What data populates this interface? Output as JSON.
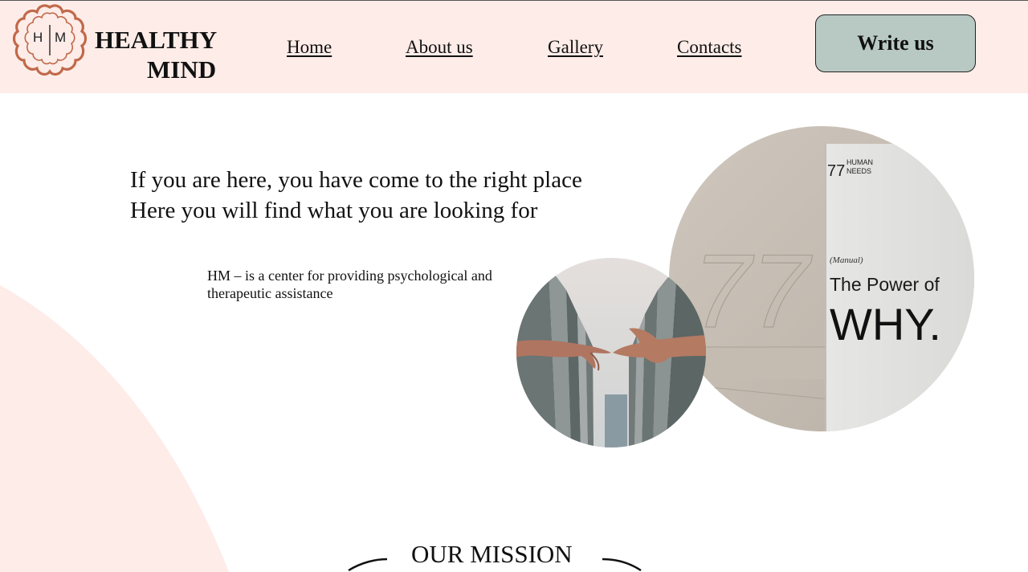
{
  "header": {
    "logo": {
      "icon": "flower-logo-icon",
      "letters_left": "H",
      "letters_right": "M",
      "color": "#c0694a"
    },
    "brand": {
      "line1": "HEALTHY",
      "line2": "MIND"
    },
    "nav": [
      {
        "label": "Home"
      },
      {
        "label": "About us"
      },
      {
        "label": "Gallery"
      },
      {
        "label": "Contacts"
      }
    ],
    "cta_label": "Write us",
    "background": "#fdece8",
    "cta_color": "#b8c9c4"
  },
  "hero": {
    "title_line1": "If you are here, you have come to the right place",
    "title_line2": "Here you will find what you are looking for",
    "description": "HM – is a center for providing psychological and therapeutic assistance"
  },
  "images": {
    "book": {
      "number": "77",
      "book_top_number": "77",
      "book_top_line1": "HUMAN",
      "book_top_line2": "NEEDS",
      "book_subtitle": "(Manual)",
      "book_title": "The Power of",
      "book_big": "WHY."
    },
    "hands": {
      "icon": "hands-reaching-photo"
    }
  },
  "mission": {
    "title": "OUR MISSION"
  }
}
